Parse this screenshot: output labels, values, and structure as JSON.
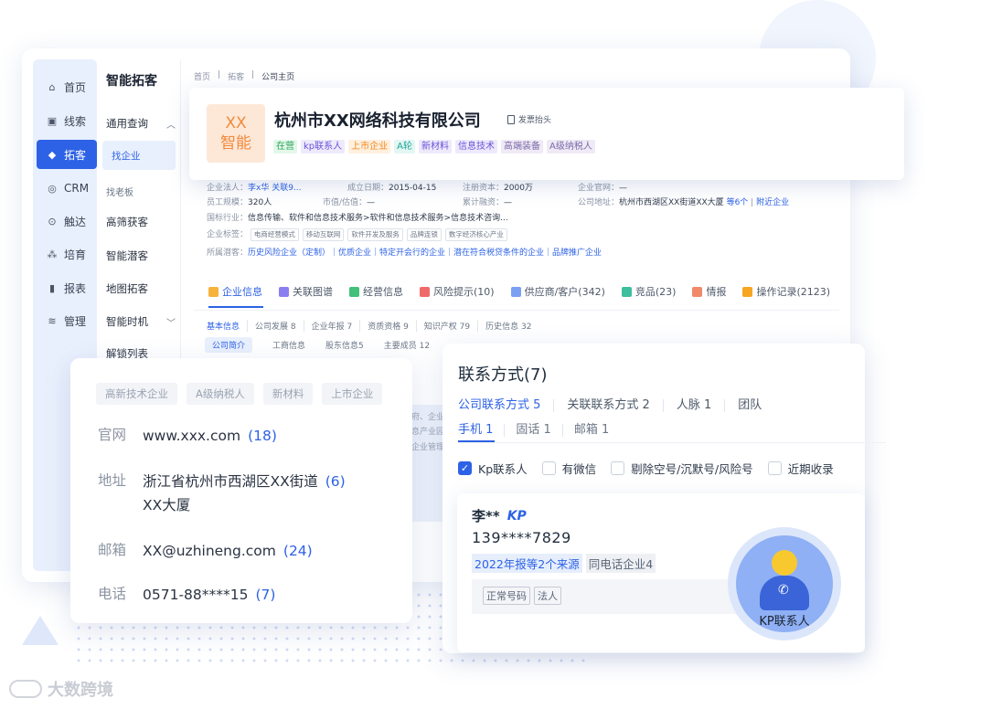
{
  "nav": {
    "items": [
      {
        "label": "首页",
        "icon": "home-icon"
      },
      {
        "label": "线索",
        "icon": "clue-icon"
      },
      {
        "label": "拓客",
        "icon": "cube-icon"
      },
      {
        "label": "CRM",
        "icon": "crm-icon"
      },
      {
        "label": "触达",
        "icon": "target-icon"
      },
      {
        "label": "培育",
        "icon": "nurture-icon"
      },
      {
        "label": "报表",
        "icon": "chart-icon"
      },
      {
        "label": "管理",
        "icon": "layers-icon"
      }
    ],
    "active": "拓客"
  },
  "sub_nav": {
    "title": "智能拓客",
    "items": [
      "通用查询",
      "找企业",
      "找老板",
      "高筛获客",
      "智能潜客",
      "地图拓客",
      "智能时机",
      "解锁列表"
    ]
  },
  "breadcrumb": [
    "首页",
    "拓客",
    "公司主页"
  ],
  "company": {
    "logo_line1": "XX",
    "logo_line2": "智能",
    "name": "杭州市XX网络科技有限公司",
    "invoice_label": "发票抬头",
    "tags": [
      "在营",
      "kp联系人",
      "上市企业",
      "A轮",
      "新材料",
      "信息技术",
      "高端装备",
      "A级纳税人"
    ]
  },
  "details": {
    "legal_label": "企业法人：",
    "legal_value": "李x华 关联9...",
    "founded_label": "成立日期：",
    "founded_value": "2015-04-15",
    "capital_label": "注册资本：",
    "capital_value": "2000万",
    "website_label": "企业官网：",
    "website_value": "—",
    "staff_label": "员工规模：",
    "staff_value": "320人",
    "valuation_label": "市值/估值：",
    "valuation_value": "—",
    "financing_label": "累计融资：",
    "financing_value": "—",
    "address_label": "公司地址：",
    "address_value": "杭州市西湖区XX街道XX大厦",
    "address_more": "等6个",
    "address_nearby": "附近企业",
    "industry_label": "国标行业：",
    "industry_value": "信息传输、软件和信息技术服务>软件和信息技术服务>信息技术咨询...",
    "biz_tags_label": "企业标签：",
    "biz_tags": [
      "电商经营模式",
      "移动互联网",
      "软件开发及服务",
      "品牌连锁",
      "数字经济核心产业"
    ],
    "potential_label": "所属潜客：",
    "potential_value": "历史风险企业（定制）｜优质企业｜特定开会行的企业｜潜在符合税贷条件的企业｜品牌推广企业"
  },
  "tabs": [
    "企业信息",
    "关联图谱",
    "经营信息",
    "风险提示(10)",
    "供应商/客户(342)",
    "竞品(23)",
    "情报",
    "操作记录(2123)"
  ],
  "subtabs": [
    "基本信息",
    "公司发展 8",
    "企业年报 7",
    "资质资格 9",
    "知识产权 79",
    "历史信息 32"
  ],
  "subtabs2": [
    "公司简介",
    "工商信息",
    "股东信息5",
    "主要成员 12"
  ],
  "faint_texts": [
    "府、企业",
    "息产业园",
    "企业管理"
  ],
  "contact_card": {
    "tags": [
      "高新技术企业",
      "A级纳税人",
      "新材料",
      "上市企业"
    ],
    "rows": [
      {
        "label": "官网",
        "value": "www.xxx.com",
        "count": "(18)"
      },
      {
        "label": "地址",
        "value_line1": "浙江省杭州市西湖区XX街道",
        "value_line2": "XX大厦",
        "count": "(6)"
      },
      {
        "label": "邮箱",
        "value": "XX@uzhineng.com",
        "count": "(24)"
      },
      {
        "label": "电话",
        "value": "0571-88****15",
        "count": "(7)"
      }
    ]
  },
  "contact_window": {
    "title": "联系方式(7)",
    "tabs": [
      "公司联系方式 5",
      "关联联系方式 2",
      "人脉 1",
      "团队"
    ],
    "subtabs": [
      "手机 1",
      "固话 1",
      "邮箱 1"
    ],
    "filters": [
      {
        "label": "Kp联系人",
        "checked": true
      },
      {
        "label": "有微信",
        "checked": false
      },
      {
        "label": "剔除空号/沉默号/风险号",
        "checked": false
      },
      {
        "label": "近期收录",
        "checked": false
      }
    ]
  },
  "person": {
    "name": "李**",
    "kp": "KP",
    "phone": "139****7829",
    "source1": "2022年报等2个来源",
    "source2": "同电话企业4",
    "tags": [
      "正常号码",
      "法人"
    ],
    "badge_label": "KP联系人"
  },
  "watermark": "大数跨境",
  "colors": {
    "accent": "#2d62e6",
    "logo_bg": "#fde8d8",
    "logo_text": "#f28a3c"
  }
}
